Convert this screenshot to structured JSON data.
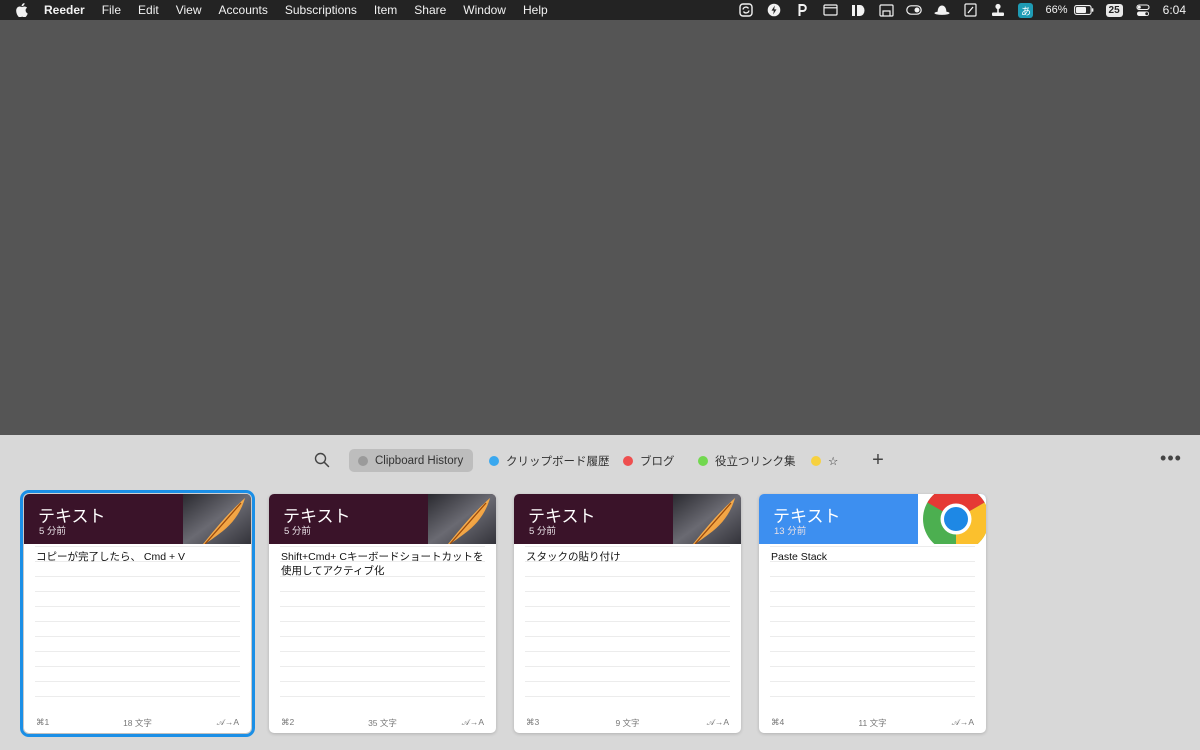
{
  "menubar": {
    "app_name": "Reeder",
    "menus": [
      "File",
      "Edit",
      "View",
      "Accounts",
      "Subscriptions",
      "Item",
      "Share",
      "Window",
      "Help"
    ],
    "status": {
      "ime_label": "あ",
      "battery": "66%",
      "date": "25",
      "clock": "6:04"
    }
  },
  "toolbar": {
    "tabs": [
      {
        "label": "Clipboard History",
        "color": "#9a9a9a",
        "active": true
      },
      {
        "label": "クリップボード履歴",
        "color": "#3aa8ef"
      },
      {
        "label": "ブログ",
        "color": "#ee4f4f"
      },
      {
        "label": "役立つリンク集",
        "color": "#72d84f"
      },
      {
        "label": "☆",
        "color": "#f7d13f"
      }
    ],
    "add_label": "+",
    "more_label": "•••"
  },
  "cards": [
    {
      "type": "テキスト",
      "time": "5 分前",
      "text": "コピーが完了したら、 Cmd + V",
      "shortcut": "⌘1",
      "count": "18 文字",
      "paste": "𝒜→A",
      "header_color": "#3a1329",
      "app_icon": "quill-icon"
    },
    {
      "type": "テキスト",
      "time": "5 分前",
      "text": "Shift+Cmd+ Cキーボードショートカットを使用してアクティブ化",
      "shortcut": "⌘2",
      "count": "35 文字",
      "paste": "𝒜→A",
      "header_color": "#3a1329",
      "app_icon": "quill-icon"
    },
    {
      "type": "テキスト",
      "time": "5 分前",
      "text": "スタックの貼り付け",
      "shortcut": "⌘3",
      "count": "9 文字",
      "paste": "𝒜→A",
      "header_color": "#3a1329",
      "app_icon": "quill-icon"
    },
    {
      "type": "テキスト",
      "time": "13 分前",
      "text": "Paste Stack",
      "shortcut": "⌘4",
      "count": "11 文字",
      "paste": "𝒜→A",
      "header_color": "#3d8ff0",
      "app_icon": "chrome-icon"
    }
  ]
}
